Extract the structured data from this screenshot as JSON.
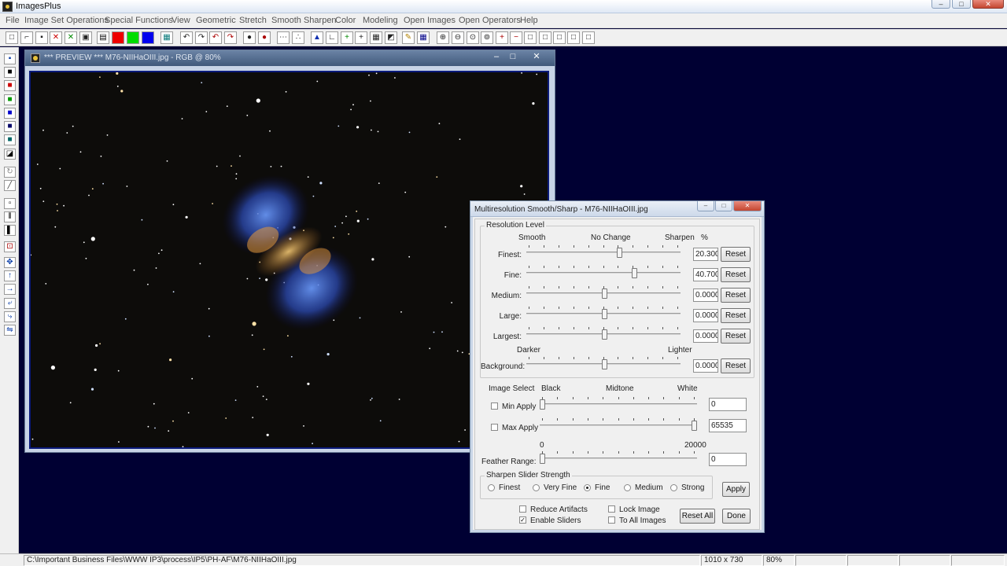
{
  "app": {
    "title": "ImagesPlus",
    "window_controls": {
      "minimize": "–",
      "maximize": "□",
      "close": "✕"
    }
  },
  "menubar": {
    "items": [
      {
        "label": "File"
      },
      {
        "label": "Image Set Operations"
      },
      {
        "label": "Special Functions"
      },
      {
        "label": "View"
      },
      {
        "label": "Geometric"
      },
      {
        "label": "Stretch"
      },
      {
        "label": "Smooth Sharpen"
      },
      {
        "label": "Color"
      },
      {
        "label": "Modeling"
      },
      {
        "label": "Open Images"
      },
      {
        "label": "Open Operators"
      },
      {
        "label": "Help"
      }
    ]
  },
  "toolbar": {
    "icons": [
      {
        "name": "new-file-icon",
        "glyph": "□"
      },
      {
        "name": "open-folder-icon",
        "glyph": "⌐"
      },
      {
        "name": "save-icon",
        "glyph": "▪"
      },
      {
        "name": "close-red-x-icon",
        "glyph": "✕",
        "color": "#cc0000"
      },
      {
        "name": "close-green-x-icon",
        "glyph": "✕",
        "color": "#008800"
      },
      {
        "name": "copy-icon",
        "glyph": "▣"
      },
      {
        "name": "rgb-channels-icon",
        "glyph": "▤",
        "color": "#000000"
      },
      {
        "name": "red-channel-icon",
        "glyph": "",
        "color": "#ee0000"
      },
      {
        "name": "green-channel-icon",
        "glyph": "",
        "color": "#00dd00"
      },
      {
        "name": "blue-channel-icon",
        "glyph": "",
        "color": "#0000ee"
      },
      {
        "name": "grid-teal-icon",
        "glyph": "▦",
        "color": "#0a7a7a"
      },
      {
        "name": "undo-icon",
        "glyph": "↶"
      },
      {
        "name": "redo-icon",
        "glyph": "↷"
      },
      {
        "name": "undo-red-icon",
        "glyph": "↶",
        "color": "#aa0000"
      },
      {
        "name": "redo-red-icon",
        "glyph": "↷",
        "color": "#aa0000"
      },
      {
        "name": "record-icon",
        "glyph": "●"
      },
      {
        "name": "record-red-icon",
        "glyph": "●",
        "color": "#aa0000"
      },
      {
        "name": "dotted-line-icon",
        "glyph": "⋯"
      },
      {
        "name": "points-icon",
        "glyph": "∴"
      },
      {
        "name": "triangle-blue-icon",
        "glyph": "▲",
        "color": "#1030b0"
      },
      {
        "name": "angle-icon",
        "glyph": "∟"
      },
      {
        "name": "plus-green-icon",
        "glyph": "+",
        "color": "#008800"
      },
      {
        "name": "crosshair-icon",
        "glyph": "+"
      },
      {
        "name": "light-grid-icon",
        "glyph": "▦"
      },
      {
        "name": "paint-icon",
        "glyph": "◩"
      },
      {
        "name": "pencil-icon",
        "glyph": "✎",
        "color": "#b08000"
      },
      {
        "name": "table-icon",
        "glyph": "▦",
        "color": "#000088"
      },
      {
        "name": "zoom-in-icon",
        "glyph": "⊕"
      },
      {
        "name": "zoom-out-icon",
        "glyph": "⊖"
      },
      {
        "name": "zoom-fit-icon",
        "glyph": "⊙"
      },
      {
        "name": "zoom-actual-icon",
        "glyph": "⊚"
      },
      {
        "name": "add-box-icon",
        "glyph": "+",
        "color": "#aa0000"
      },
      {
        "name": "minus-box-icon",
        "glyph": "−",
        "color": "#aa0000"
      },
      {
        "name": "square-1-icon",
        "glyph": "□"
      },
      {
        "name": "square-2-icon",
        "glyph": "□"
      },
      {
        "name": "square-3-icon",
        "glyph": "□"
      },
      {
        "name": "square-4-icon",
        "glyph": "□"
      },
      {
        "name": "square-5-icon",
        "glyph": "□"
      }
    ]
  },
  "lefttools": {
    "icons": [
      {
        "name": "save-tool-icon",
        "glyph": "▪"
      },
      {
        "name": "black-white-tool-icon",
        "glyph": "■",
        "color": "#000000"
      },
      {
        "name": "red-tool-icon",
        "glyph": "■",
        "color": "#cc0000"
      },
      {
        "name": "green-tool-icon",
        "glyph": "■",
        "color": "#009900"
      },
      {
        "name": "blue-tool-icon",
        "glyph": "■",
        "color": "#0000cc"
      },
      {
        "name": "navy-tool-icon",
        "glyph": "■",
        "color": "#000066"
      },
      {
        "name": "teal-tool-icon",
        "glyph": "■",
        "color": "#006666"
      },
      {
        "name": "dark-tool-icon",
        "glyph": "◪",
        "color": "#000000"
      },
      {
        "name": "grey-tool-icon",
        "glyph": "↻",
        "color": "#888888"
      },
      {
        "name": "diagonal-tool-icon",
        "glyph": "╱",
        "color": "#444444"
      },
      {
        "name": "square-tool-icon",
        "glyph": "▫",
        "color": "#000000"
      },
      {
        "name": "bars-tool-icon",
        "glyph": "⦀",
        "color": "#000000"
      },
      {
        "name": "black-bar-tool-icon",
        "glyph": "▌",
        "color": "#000000"
      },
      {
        "name": "crop-tool-icon",
        "glyph": "⊡",
        "color": "#aa0000"
      },
      {
        "name": "move-tool-icon",
        "glyph": "✥",
        "color": "#0b3ea8"
      },
      {
        "name": "arrow-up-tool-icon",
        "glyph": "↑",
        "color": "#0b3ea8"
      },
      {
        "name": "arrow-right-tool-icon",
        "glyph": "→",
        "color": "#0b3ea8"
      },
      {
        "name": "rotate-left-tool-icon",
        "glyph": "⤶",
        "color": "#0b3ea8"
      },
      {
        "name": "rotate-right-tool-icon",
        "glyph": "⤷",
        "color": "#0b3ea8"
      },
      {
        "name": "flip-tool-icon",
        "glyph": "⇋",
        "color": "#0b3ea8"
      }
    ]
  },
  "preview_window": {
    "title": "*** PREVIEW *** M76-NIIHaOIII.jpg - RGB @ 80%",
    "controls": {
      "minimize": "–",
      "maximize": "□",
      "close": "✕"
    }
  },
  "dialog": {
    "title": "Multiresolution Smooth/Sharp - M76-NIIHaOIII.jpg",
    "controls": {
      "minimize": "–",
      "maximize": "□",
      "close": "✕"
    },
    "resolution_level": {
      "group_label": "Resolution Level",
      "header_smooth": "Smooth",
      "header_no_change": "No Change",
      "header_sharpen": "Sharpen",
      "header_percent": "%",
      "header_darker": "Darker",
      "header_lighter": "Lighter",
      "rows": [
        {
          "label": "Finest:",
          "value": "20.3000",
          "fraction": 0.61,
          "reset": "Reset"
        },
        {
          "label": "Fine:",
          "value": "40.7000",
          "fraction": 0.71,
          "reset": "Reset"
        },
        {
          "label": "Medium:",
          "value": "0.0000",
          "fraction": 0.51,
          "reset": "Reset"
        },
        {
          "label": "Large:",
          "value": "0.0000",
          "fraction": 0.51,
          "reset": "Reset"
        },
        {
          "label": "Largest:",
          "value": "0.0000",
          "fraction": 0.51,
          "reset": "Reset"
        },
        {
          "label": "Background:",
          "value": "0.0000",
          "fraction": 0.51,
          "reset": "Reset"
        }
      ]
    },
    "image_select": {
      "label": "Image Select",
      "black": "Black",
      "midtone": "Midtone",
      "white": "White",
      "min_apply": {
        "label": "Min Apply",
        "checked": false,
        "value": "0",
        "fraction": 0.0
      },
      "max_apply": {
        "label": "Max Apply",
        "checked": false,
        "value": "65535",
        "fraction": 1.0
      },
      "range_min": "0",
      "range_max": "20000",
      "feather": {
        "label": "Feather Range:",
        "value": "0",
        "fraction": 0.0
      }
    },
    "sharpen_strength": {
      "group_label": "Sharpen Slider Strength",
      "options": [
        {
          "label": "Finest",
          "selected": false
        },
        {
          "label": "Very Fine",
          "selected": false
        },
        {
          "label": "Fine",
          "selected": true
        },
        {
          "label": "Medium",
          "selected": false
        },
        {
          "label": "Strong",
          "selected": false
        }
      ],
      "apply": "Apply"
    },
    "options": {
      "reduce_artifacts": {
        "label": "Reduce Artifacts",
        "checked": false
      },
      "enable_sliders": {
        "label": "Enable Sliders",
        "checked": true
      },
      "lock_image": {
        "label": "Lock Image",
        "checked": false
      },
      "to_all_images": {
        "label": "To All Images",
        "checked": false
      }
    },
    "reset_all": "Reset All",
    "done": "Done"
  },
  "statusbar": {
    "path": "C:\\Important Business Files\\WWW IP3\\process\\IP5\\PH-AF\\M76-NIIHaOIII.jpg",
    "dimensions": "1010 x 730",
    "zoom": "80%"
  },
  "colors": {
    "desktop_bg": "#000033",
    "preview_frame": "#0a1a7a",
    "window_title_gradient": "#41597b"
  }
}
